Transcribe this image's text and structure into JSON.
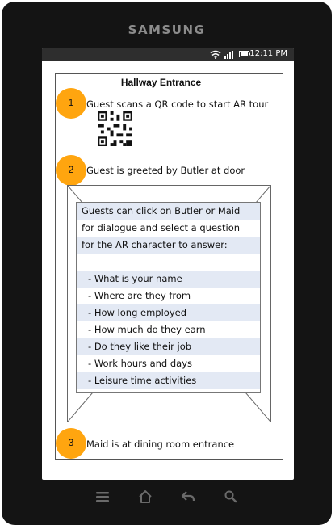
{
  "device": {
    "brand": "SAMSUNG"
  },
  "status_bar": {
    "time": "12:11 PM"
  },
  "page": {
    "title": "Hallway Entrance"
  },
  "steps": [
    {
      "number": "1",
      "text": "Guest scans a QR code to start AR tour"
    },
    {
      "number": "2",
      "text": "Guest is greeted by Butler at door"
    },
    {
      "number": "3",
      "text": "Maid is at dining room entrance"
    }
  ],
  "dialog": {
    "intro_lines": [
      "Guests can click on Butler or Maid",
      "for dialogue and select a question",
      "for the AR character to answer:"
    ],
    "questions": [
      "What is your name",
      "Where are they from",
      "How long employed",
      "How much do they earn",
      "Do they like their job",
      "Work hours and days",
      "Leisure time activities"
    ]
  },
  "colors": {
    "badge": "#ffa50f",
    "row_alt": "#e3e9f4",
    "phone_body": "#141414"
  },
  "nav_icons": [
    "menu-icon",
    "home-icon",
    "back-icon",
    "search-icon"
  ]
}
